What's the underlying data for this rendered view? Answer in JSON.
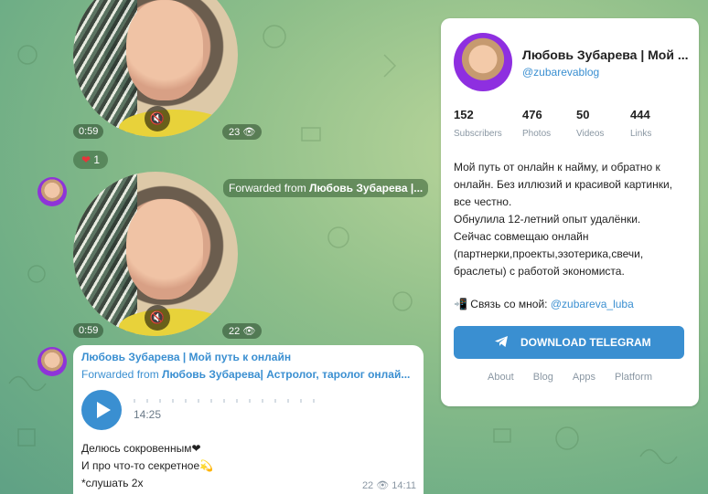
{
  "video1": {
    "duration": "0:59",
    "views": "23"
  },
  "reaction": {
    "emoji": "❤",
    "count": "1"
  },
  "forward_tag": {
    "prefix": "Forwarded from ",
    "name": "Любовь Зубарева |..."
  },
  "video2": {
    "duration": "0:59",
    "views": "22"
  },
  "message": {
    "author": "Любовь Зубарева | Мой путь к онлайн",
    "forward_prefix": "Forwarded from ",
    "forward_name": "Любовь Зубарева| Астролог, таролог онлай...",
    "audio_duration": "14:25",
    "text_line1": "Делюсь сокровенным❤",
    "text_line2": "И про что-то секретное💫",
    "text_line3": "*слушать 2х",
    "views": "22",
    "time": "14:11"
  },
  "channel": {
    "name": "Любовь Зубарева | Мой ...",
    "handle": "@zubarevablog",
    "stats": [
      {
        "value": "152",
        "label": "Subscribers"
      },
      {
        "value": "476",
        "label": "Photos"
      },
      {
        "value": "50",
        "label": "Videos"
      },
      {
        "value": "444",
        "label": "Links"
      }
    ],
    "description": "Мой путь от онлайн к найму, и обратно к онлайн. Без иллюзий и красивой картинки, все честно.\nОбнулила 12-летний опыт удалёнки.\nСейчас совмещаю онлайн (партнерки,проекты,эзотерика,свечи, браслеты) с работой экономиста.",
    "contact_prefix": "📲 Связь со мной: ",
    "contact_handle": "@zubareva_luba",
    "download_label": "DOWNLOAD TELEGRAM",
    "footer_links": [
      "About",
      "Blog",
      "Apps",
      "Platform"
    ]
  },
  "colors": {
    "accent": "#3a8fd1",
    "background": "#8fbf8a"
  }
}
